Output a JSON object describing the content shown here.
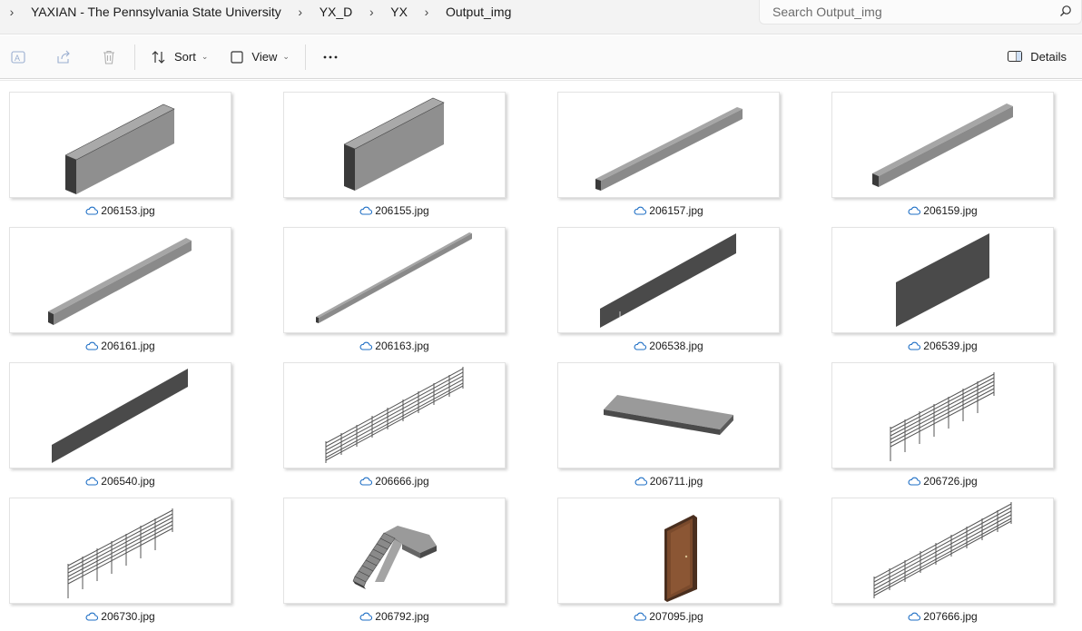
{
  "breadcrumb": {
    "items": [
      "YAXIAN - The Pennsylvania State University",
      "YX_D",
      "YX",
      "Output_img"
    ]
  },
  "search": {
    "placeholder": "Search Output_img"
  },
  "toolbar": {
    "sort_label": "Sort",
    "view_label": "View",
    "details_label": "Details"
  },
  "files": [
    {
      "name": "206153.jpg",
      "thumb": "wall-thick"
    },
    {
      "name": "206155.jpg",
      "thumb": "wall-thick"
    },
    {
      "name": "206157.jpg",
      "thumb": "beam"
    },
    {
      "name": "206159.jpg",
      "thumb": "beam"
    },
    {
      "name": "206161.jpg",
      "thumb": "beam-long"
    },
    {
      "name": "206163.jpg",
      "thumb": "bar-thin"
    },
    {
      "name": "206538.jpg",
      "thumb": "panel-dark"
    },
    {
      "name": "206539.jpg",
      "thumb": "panel-wide"
    },
    {
      "name": "206540.jpg",
      "thumb": "panel-dark-long"
    },
    {
      "name": "206666.jpg",
      "thumb": "railing"
    },
    {
      "name": "206711.jpg",
      "thumb": "slab"
    },
    {
      "name": "206726.jpg",
      "thumb": "railing-steep"
    },
    {
      "name": "206730.jpg",
      "thumb": "railing-steep"
    },
    {
      "name": "206792.jpg",
      "thumb": "stairs"
    },
    {
      "name": "207095.jpg",
      "thumb": "door"
    },
    {
      "name": "207666.jpg",
      "thumb": "railing"
    }
  ],
  "colors": {
    "cloud_icon": "#1f6fc5",
    "accent": "#0a64c8"
  }
}
